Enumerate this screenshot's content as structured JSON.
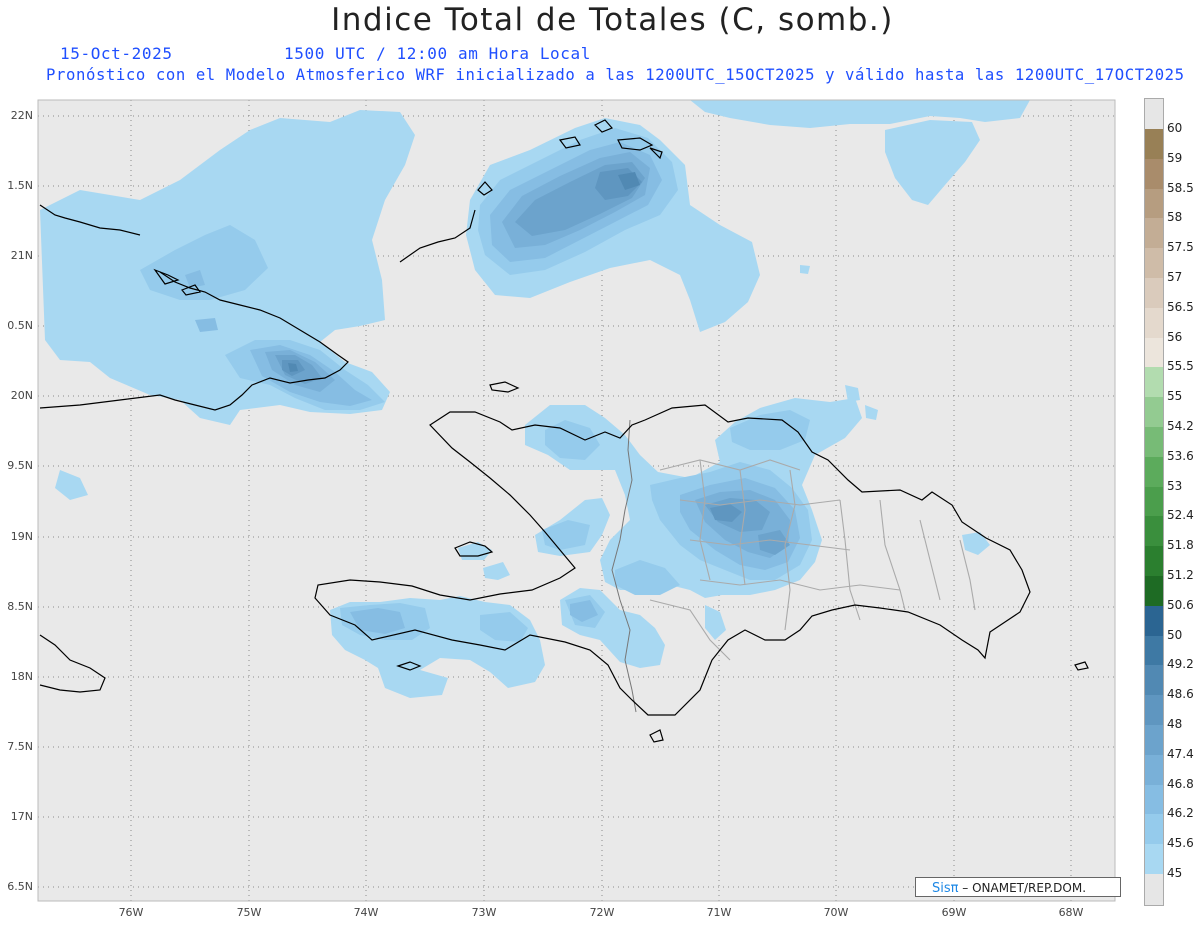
{
  "header": {
    "title": "Indice Total de Totales (C, somb.)",
    "date": "15-Oct-2025",
    "time": "1500 UTC / 12:00 am Hora Local",
    "description": "Pronóstico con el Modelo Atmosferico WRF inicializado a las 1200UTC_15OCT2025 y válido hasta las  1200UTC_17OCT2025"
  },
  "map": {
    "lat_labels": [
      "22N",
      "1.5N",
      "21N",
      "0.5N",
      "20N",
      "9.5N",
      "19N",
      "8.5N",
      "18N",
      "7.5N",
      "17N",
      "6.5N"
    ],
    "lon_labels": [
      "76W",
      "75W",
      "74W",
      "73W",
      "72W",
      "71W",
      "70W",
      "69W",
      "68W"
    ],
    "ocean_color": "#e9e9e9",
    "coast_color": "#000000",
    "border_color": "#999999"
  },
  "legend": {
    "levels": [
      "45",
      "45.6",
      "46.2",
      "46.8",
      "47.4",
      "48",
      "48.6",
      "49.2",
      "50",
      "50.6",
      "51.2",
      "51.8",
      "52.4",
      "53",
      "53.6",
      "54.2",
      "55",
      "55.5",
      "56",
      "56.5",
      "57",
      "57.5",
      "58",
      "58.5",
      "59",
      "60"
    ],
    "colors": [
      "#a8d8f2",
      "#95cbec",
      "#86bde3",
      "#79b0d8",
      "#6ca3cc",
      "#5f96c0",
      "#5189b3",
      "#3e79a4",
      "#2b6592",
      "#1e6b24",
      "#2b7f2f",
      "#3a8f3d",
      "#4b9e4c",
      "#5cab5c",
      "#77bb76",
      "#93cb91",
      "#b2dcaf",
      "#ece5dc",
      "#e4d9cd",
      "#dacbbc",
      "#cfbca8",
      "#c3ad95",
      "#b69d80",
      "#a98c6b",
      "#988056"
    ]
  },
  "credit": {
    "brand": "Sisπ",
    "org": "– ONAMET/REP.DOM."
  }
}
